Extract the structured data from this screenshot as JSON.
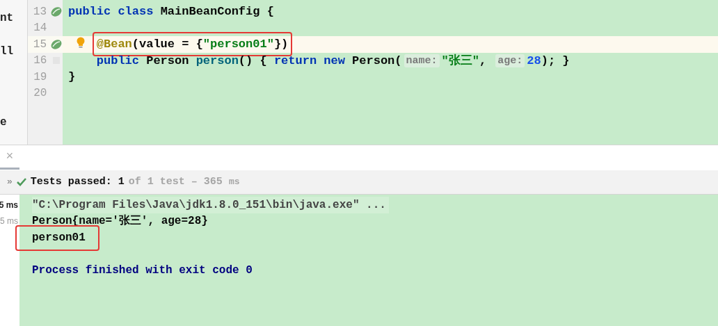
{
  "left_panel": {
    "fragments": [
      {
        "text": "nt"
      },
      {
        "text": "ll"
      },
      {
        "text": "e"
      }
    ]
  },
  "editor": {
    "lines": [
      {
        "number": "13",
        "bean": true,
        "segments": [
          {
            "text": "public class ",
            "kind": "keyword"
          },
          {
            "text": "MainBeanConfig",
            "kind": "plain"
          },
          {
            "text": " {",
            "kind": "plain"
          }
        ]
      },
      {
        "number": "14"
      },
      {
        "number": "15",
        "bean": true,
        "current": true,
        "bulb": true,
        "boxed": true,
        "indented": true,
        "segments": [
          {
            "text": "@Bean",
            "kind": "annotation"
          },
          {
            "text": "(value = {",
            "kind": "plain"
          },
          {
            "text": "\"person01\"",
            "kind": "string"
          },
          {
            "text": "})",
            "kind": "plain"
          }
        ]
      },
      {
        "number": "16",
        "fold": true,
        "indented": true,
        "segments": [
          {
            "text": "public ",
            "kind": "keyword"
          },
          {
            "text": "Person ",
            "kind": "plain"
          },
          {
            "text": "person",
            "kind": "method"
          },
          {
            "text": "() { ",
            "kind": "plain"
          },
          {
            "text": "return new ",
            "kind": "keyword"
          },
          {
            "text": "Person(",
            "kind": "plain"
          },
          {
            "text": "name:",
            "kind": "hint"
          },
          {
            "text": "\"张三\"",
            "kind": "string"
          },
          {
            "text": ", ",
            "kind": "plain"
          },
          {
            "text": "age:",
            "kind": "hint"
          },
          {
            "text": "28",
            "kind": "number"
          },
          {
            "text": "); }",
            "kind": "plain"
          }
        ]
      },
      {
        "number": "19",
        "segments": [
          {
            "text": "}",
            "kind": "plain"
          }
        ]
      },
      {
        "number": "20"
      }
    ]
  },
  "tool_window": {
    "close": "×"
  },
  "test_bar": {
    "expand": "»",
    "passed": "Tests passed: 1",
    "detail": "of 1 test – 365",
    "unit": "ms"
  },
  "timings": [
    {
      "value": "5",
      "unit": "ms",
      "selected": true
    },
    {
      "value": "5",
      "unit": "ms",
      "selected": false
    }
  ],
  "console": {
    "lines": [
      {
        "text": "\"C:\\Program Files\\Java\\jdk1.8.0_151\\bin\\java.exe\" ...",
        "kind": "command"
      },
      {
        "text": "Person{name='张三', age=28}",
        "kind": "output"
      },
      {
        "text": "person01",
        "kind": "output",
        "boxed": true
      },
      {
        "kind": "blank"
      },
      {
        "text": "Process finished with exit code 0",
        "kind": "exit"
      }
    ]
  }
}
